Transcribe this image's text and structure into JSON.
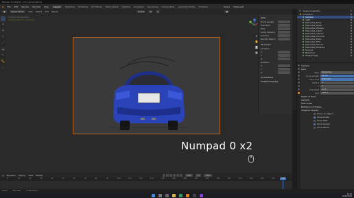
{
  "window": {
    "title": "Blender [C:\\Users\\...\\car_render.blend]"
  },
  "menubar": {
    "items": [
      "File",
      "Edit",
      "Render",
      "Window",
      "Help"
    ],
    "workspaces": [
      "Layout",
      "Modeling",
      "Sculpting",
      "UV Editing",
      "Texture Paint",
      "Shading",
      "Animation",
      "Rendering",
      "Compositing",
      "Geometry Nodes",
      "Scripting"
    ],
    "active_workspace": "Layout",
    "scene": "Scene",
    "view_layer": "ViewLayer"
  },
  "header3d": {
    "mode": "Object Mode",
    "items": [
      "View",
      "Select",
      "Add",
      "Object"
    ],
    "transform": "Global"
  },
  "viewport": {
    "camera_line1": "Camera Perspective",
    "camera_line2": "(150) Collection | Camera",
    "overlay_text": "Numpad 0 x2"
  },
  "npanel": {
    "header": "View",
    "rows": [
      "Focal Length",
      "Clip Start",
      "End",
      "Local Camera",
      "Camera",
      "Render Region"
    ],
    "sections": [
      "3D Cursor",
      "Location",
      "Rotation",
      "Annotations",
      "Viewport Display"
    ]
  },
  "timeline": {
    "menu": [
      "Playback",
      "Keying",
      "View",
      "Marker"
    ],
    "frame_current": "150",
    "start": "1",
    "end": "250",
    "ruler": [
      "0",
      "10",
      "20",
      "30",
      "40",
      "50",
      "60",
      "70",
      "80",
      "90",
      "100",
      "110",
      "120",
      "130",
      "140",
      "150",
      "160",
      "170",
      "180",
      "190",
      "200",
      "210",
      "220",
      "230",
      "240",
      "250"
    ]
  },
  "statusbar": {
    "items": [
      "Select",
      "Pan View",
      "Context Menu"
    ]
  },
  "outliner": {
    "header": "Scene Collection",
    "items": [
      {
        "label": "Collection",
        "selected": false,
        "kind": "collection"
      },
      {
        "label": "Camera",
        "selected": true,
        "kind": "object"
      },
      {
        "label": "Light",
        "selected": false,
        "kind": "object"
      },
      {
        "label": "Mercedes_Body",
        "selected": false,
        "kind": "object"
      },
      {
        "label": "Mercedes_Glass",
        "selected": false,
        "kind": "object"
      },
      {
        "label": "Mercedes_Wheels",
        "selected": false,
        "kind": "object"
      },
      {
        "label": "Mercedes_Lights",
        "selected": false,
        "kind": "object"
      },
      {
        "label": "Mercedes_Interior",
        "selected": false,
        "kind": "object"
      },
      {
        "label": "Mercedes_Chrome",
        "selected": false,
        "kind": "object"
      },
      {
        "label": "Mercedes_Plate",
        "selected": false,
        "kind": "object"
      },
      {
        "label": "Mercedes_Trim",
        "selected": false,
        "kind": "object"
      },
      {
        "label": "Mercedes_Mirrors",
        "selected": false,
        "kind": "object"
      },
      {
        "label": "Mercedes_Exhaust",
        "selected": false,
        "kind": "object"
      },
      {
        "label": "Ground",
        "selected": false,
        "kind": "object"
      },
      {
        "label": "Backdrop",
        "selected": false,
        "kind": "object"
      },
      {
        "label": "HDRI_Empty",
        "selected": false,
        "kind": "object"
      }
    ]
  },
  "properties": {
    "title": "Camera",
    "lens_section": "Lens",
    "rows": [
      {
        "label": "Type",
        "value": "Perspective",
        "highlight": false
      },
      {
        "label": "Focal Length",
        "value": "50 mm",
        "highlight": true
      },
      {
        "label": "Lens Unit",
        "value": "Millimeters",
        "highlight": true
      },
      {
        "label": "Shift X",
        "value": "0",
        "highlight": false
      },
      {
        "label": "Y",
        "value": "0",
        "highlight": false
      },
      {
        "label": "Clip Start",
        "value": "0.1 m",
        "highlight": false
      },
      {
        "label": "End",
        "value": "1000 m",
        "highlight": false
      }
    ],
    "sections": [
      "Depth of Field",
      "Camera",
      "Safe Areas",
      "Background Images",
      "Viewport Display"
    ],
    "checkboxes": [
      {
        "label": "Focus on Object",
        "checked": false
      },
      {
        "label": "Show Limits",
        "checked": true
      },
      {
        "label": "Show Mist",
        "checked": false
      },
      {
        "label": "Show Sensor",
        "checked": true
      },
      {
        "label": "Show Name",
        "checked": false
      }
    ]
  },
  "taskbar": {
    "time": "10:42",
    "date": "12/03/2023"
  },
  "colors": {
    "accent": "#4772b3",
    "camera_frame": "#b2691e",
    "car_body": "#2a43b8",
    "viewport_bg": "#393939"
  }
}
